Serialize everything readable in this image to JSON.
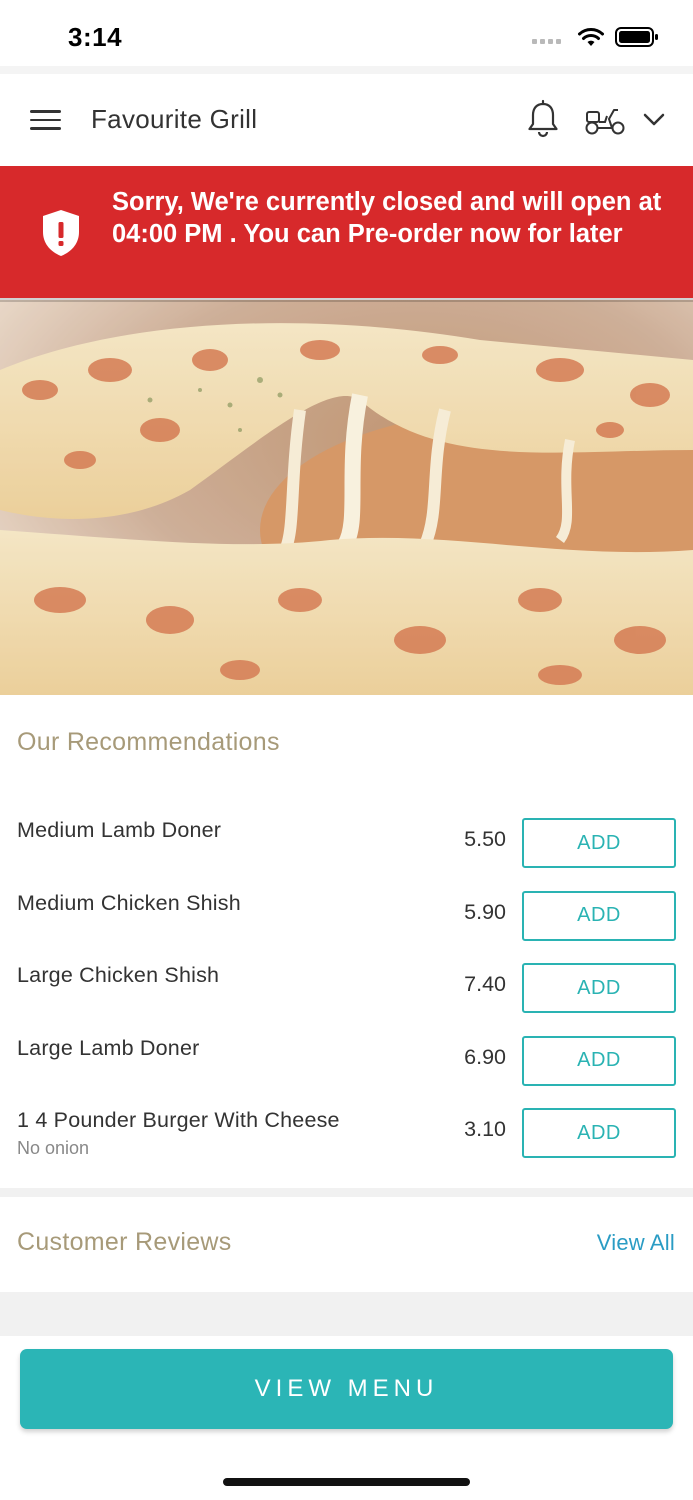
{
  "status_bar": {
    "time": "3:14"
  },
  "header": {
    "title": "Favourite Grill",
    "icons": [
      "menu-icon",
      "bell-icon",
      "delivery-scooter-icon",
      "chevron-down-icon"
    ]
  },
  "banner": {
    "message": "Sorry, We're currently closed and will open at 04:00 PM . You can Pre-order now for later",
    "color": "#d7292b",
    "icon": "shield-alert-icon"
  },
  "hero": {
    "image": "cheese-pizza-slice-photo"
  },
  "recommendations": {
    "title": "Our Recommendations",
    "add_label": "ADD",
    "items": [
      {
        "name": "Medium Lamb Doner",
        "note": "",
        "price": "5.50"
      },
      {
        "name": "Medium Chicken Shish",
        "note": "",
        "price": "5.90"
      },
      {
        "name": "Large Chicken Shish",
        "note": "",
        "price": "7.40"
      },
      {
        "name": "Large Lamb Doner",
        "note": "",
        "price": "6.90"
      },
      {
        "name": "1 4 Pounder Burger With Cheese",
        "note": "No onion",
        "price": "3.10"
      }
    ]
  },
  "reviews": {
    "title": "Customer Reviews",
    "view_all": "View All"
  },
  "cta": {
    "label": "VIEW MENU",
    "color": "#2bb5b6"
  },
  "colors": {
    "accent": "#2ab3b3",
    "section_title": "#a79a79",
    "link": "#2a9cc4"
  }
}
